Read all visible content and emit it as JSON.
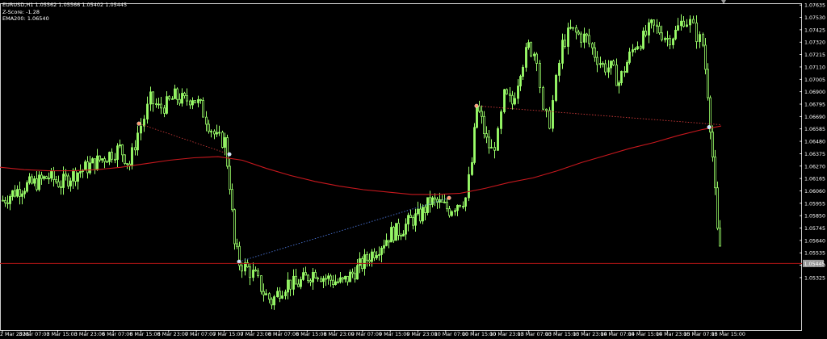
{
  "info": {
    "symbol_line": "EURUSD,H1  1.05562 1.05566 1.05402 1.05445",
    "zscore_line": "Z-Score: -1.28",
    "ema_line": "EMA200: 1.06540"
  },
  "chart_data": {
    "type": "candlestick",
    "symbol": "EURUSD",
    "timeframe": "H1",
    "ylim": [
      1.0488,
      1.0765
    ],
    "y_ticks": [
      "1.07635",
      "1.07530",
      "1.07425",
      "1.07320",
      "1.07215",
      "1.07110",
      "1.07005",
      "1.06900",
      "1.06795",
      "1.06690",
      "1.06585",
      "1.06480",
      "1.06375",
      "1.06270",
      "1.06165",
      "1.06060",
      "1.05955",
      "1.05850",
      "1.05745",
      "1.05640",
      "1.05535",
      "1.05430",
      "1.05325"
    ],
    "x_ticks": [
      "2 Mar 2023",
      "3 Mar 07:00",
      "3 Mar 15:00",
      "3 Mar 23:00",
      "6 Mar 07:00",
      "6 Mar 15:00",
      "6 Mar 23:00",
      "7 Mar 07:00",
      "7 Mar 15:00",
      "7 Mar 23:00",
      "8 Mar 07:00",
      "8 Mar 15:00",
      "8 Mar 23:00",
      "9 Mar 07:00",
      "9 Mar 15:00",
      "9 Mar 23:00",
      "10 Mar 07:00",
      "10 Mar 15:00",
      "10 Mar 23:00",
      "13 Mar 07:00",
      "13 Mar 15:00",
      "13 Mar 23:00",
      "14 Mar 07:00",
      "14 Mar 15:00",
      "14 Mar 23:00",
      "15 Mar 07:00",
      "15 Mar 15:00"
    ],
    "current_price_label": "1.05445",
    "current_price": 1.05445,
    "candle_color": "#9bff6a",
    "ema_color": "#c8181e",
    "ema_points": [
      [
        0,
        1.0626
      ],
      [
        30,
        1.0624
      ],
      [
        60,
        1.0623
      ],
      [
        90,
        1.0623
      ],
      [
        120,
        1.0624
      ],
      [
        150,
        1.0626
      ],
      [
        180,
        1.0629
      ],
      [
        210,
        1.0632
      ],
      [
        240,
        1.0634
      ],
      [
        270,
        1.0635
      ],
      [
        300,
        1.0632
      ],
      [
        330,
        1.0625
      ],
      [
        360,
        1.0619
      ],
      [
        390,
        1.0614
      ],
      [
        420,
        1.061
      ],
      [
        450,
        1.0607
      ],
      [
        480,
        1.0605
      ],
      [
        510,
        1.0603
      ],
      [
        540,
        1.0603
      ],
      [
        570,
        1.0604
      ],
      [
        600,
        1.0608
      ],
      [
        630,
        1.0613
      ],
      [
        660,
        1.0617
      ],
      [
        690,
        1.0623
      ],
      [
        720,
        1.063
      ],
      [
        750,
        1.0636
      ],
      [
        780,
        1.0642
      ],
      [
        810,
        1.0647
      ],
      [
        840,
        1.0653
      ],
      [
        870,
        1.0658
      ],
      [
        893,
        1.0661
      ]
    ],
    "candle_points": [
      [
        3,
        1.0598
      ],
      [
        15,
        1.0604
      ],
      [
        30,
        1.061
      ],
      [
        45,
        1.0613
      ],
      [
        60,
        1.0618
      ],
      [
        75,
        1.0612
      ],
      [
        90,
        1.062
      ],
      [
        105,
        1.0625
      ],
      [
        120,
        1.0631
      ],
      [
        135,
        1.0637
      ],
      [
        148,
        1.0642
      ],
      [
        160,
        1.0628
      ],
      [
        170,
        1.0655
      ],
      [
        178,
        1.0668
      ],
      [
        186,
        1.0683
      ],
      [
        196,
        1.0676
      ],
      [
        206,
        1.0679
      ],
      [
        216,
        1.0686
      ],
      [
        228,
        1.0682
      ],
      [
        238,
        1.0686
      ],
      [
        248,
        1.0677
      ],
      [
        258,
        1.0663
      ],
      [
        268,
        1.065
      ],
      [
        278,
        1.0648
      ],
      [
        284,
        1.0612
      ],
      [
        290,
        1.056
      ],
      [
        296,
        1.0545
      ],
      [
        306,
        1.054
      ],
      [
        316,
        1.0533
      ],
      [
        326,
        1.052
      ],
      [
        336,
        1.0512
      ],
      [
        346,
        1.0522
      ],
      [
        356,
        1.0528
      ],
      [
        366,
        1.0526
      ],
      [
        378,
        1.0532
      ],
      [
        390,
        1.0538
      ],
      [
        400,
        1.0533
      ],
      [
        412,
        1.053
      ],
      [
        424,
        1.0528
      ],
      [
        436,
        1.0536
      ],
      [
        448,
        1.0544
      ],
      [
        460,
        1.0553
      ],
      [
        472,
        1.0561
      ],
      [
        484,
        1.057
      ],
      [
        496,
        1.0573
      ],
      [
        508,
        1.0581
      ],
      [
        520,
        1.0585
      ],
      [
        532,
        1.0597
      ],
      [
        544,
        1.0595
      ],
      [
        556,
        1.059
      ],
      [
        566,
        1.0596
      ],
      [
        576,
        1.06
      ],
      [
        584,
        1.063
      ],
      [
        590,
        1.0678
      ],
      [
        596,
        1.0665
      ],
      [
        602,
        1.0648
      ],
      [
        608,
        1.064
      ],
      [
        616,
        1.0652
      ],
      [
        624,
        1.0686
      ],
      [
        634,
        1.068
      ],
      [
        644,
        1.071
      ],
      [
        654,
        1.0728
      ],
      [
        664,
        1.0721
      ],
      [
        672,
        1.067
      ],
      [
        680,
        1.0665
      ],
      [
        688,
        1.0698
      ],
      [
        696,
        1.073
      ],
      [
        706,
        1.0742
      ],
      [
        716,
        1.0738
      ],
      [
        726,
        1.0735
      ],
      [
        736,
        1.0722
      ],
      [
        746,
        1.0712
      ],
      [
        756,
        1.071
      ],
      [
        766,
        1.0698
      ],
      [
        776,
        1.0715
      ],
      [
        786,
        1.073
      ],
      [
        796,
        1.0735
      ],
      [
        806,
        1.0745
      ],
      [
        816,
        1.0742
      ],
      [
        826,
        1.0735
      ],
      [
        836,
        1.074
      ],
      [
        846,
        1.0752
      ],
      [
        854,
        1.0748
      ],
      [
        862,
        1.0738
      ],
      [
        870,
        1.073
      ],
      [
        876,
        1.069
      ],
      [
        882,
        1.0635
      ],
      [
        888,
        1.057
      ],
      [
        894,
        1.0548
      ]
    ],
    "red_line": [
      [
        172,
        1.0663
      ],
      [
        284,
        1.0637
      ]
    ],
    "blue_line": [
      [
        296,
        1.0546
      ],
      [
        556,
        1.06
      ]
    ],
    "red_line2": [
      [
        590,
        1.0678
      ],
      [
        893,
        1.0662
      ]
    ],
    "markers": [
      {
        "x": 172,
        "y": 1.0663,
        "color": "#ff9a70"
      },
      {
        "x": 284,
        "y": 1.0637,
        "color": "#c9e6ff"
      },
      {
        "x": 296,
        "y": 1.0546,
        "color": "#c9e6ff"
      },
      {
        "x": 556,
        "y": 1.06,
        "color": "#ff9a70"
      },
      {
        "x": 590,
        "y": 1.0678,
        "color": "#ff9a70"
      },
      {
        "x": 878,
        "y": 1.066,
        "color": "#c9e6ff"
      }
    ]
  }
}
